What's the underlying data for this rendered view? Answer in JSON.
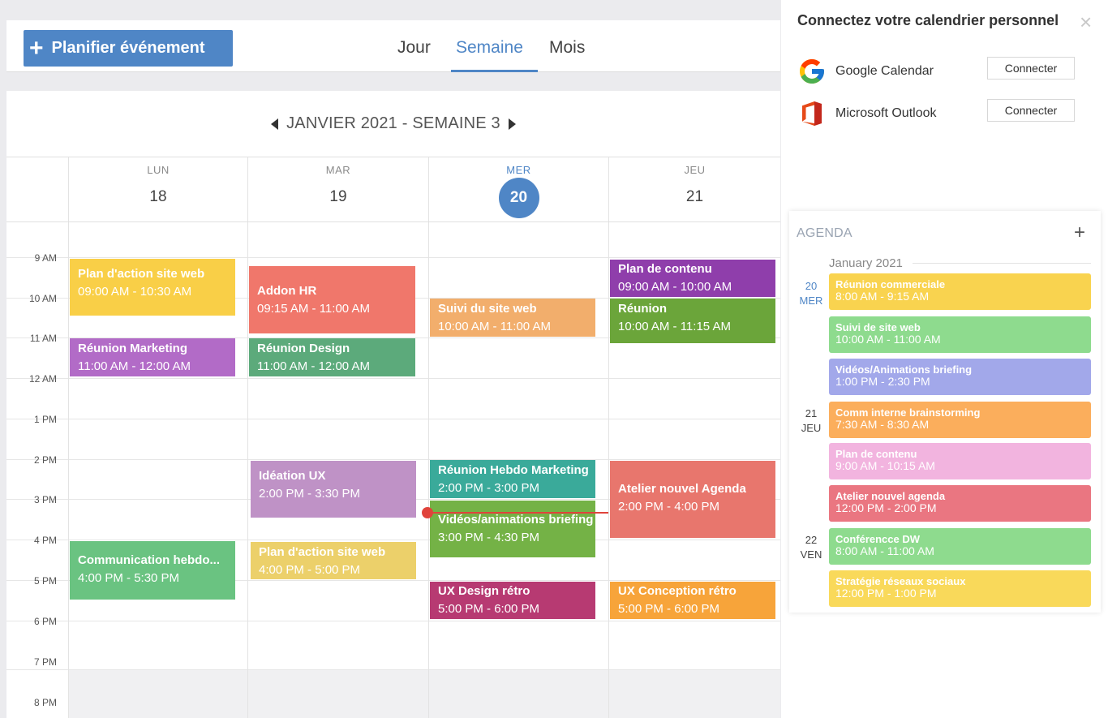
{
  "toolbar": {
    "plan_button_label": "Planifier événement",
    "plan_button_icon": "+",
    "tabs": [
      "Jour",
      "Semaine",
      "Mois"
    ],
    "active_tab": "Semaine"
  },
  "calendar": {
    "title": "JANVIER 2021 - SEMAINE 3",
    "days": [
      {
        "name": "LUN",
        "num": "18"
      },
      {
        "name": "MAR",
        "num": "19"
      },
      {
        "name": "MER",
        "num": "20"
      },
      {
        "name": "JEU",
        "num": "21"
      }
    ],
    "today": "20",
    "hours": [
      "9 AM",
      "10 AM",
      "11 AM",
      "12 AM",
      "1 PM",
      "2 PM",
      "3 PM",
      "4 PM",
      "5 PM",
      "6 PM",
      "7 PM",
      "8 PM"
    ],
    "events": [
      {
        "title": "Plan d'action site web",
        "time": "09:00 AM - 10:30 AM",
        "color": "#f9cf47"
      },
      {
        "title": "Réunion Marketing",
        "time": "11:00 AM - 12:00 AM",
        "color": "#b26bc7"
      },
      {
        "title": "Communication hebdo...",
        "time": "4:00 PM - 5:30 PM",
        "color": "#6ac381"
      },
      {
        "title": "Addon HR",
        "time": "09:15 AM - 11:00 AM",
        "color": "#f0776b"
      },
      {
        "title": "Réunion Design",
        "time": "11:00 AM - 12:00 AM",
        "color": "#5caa7b"
      },
      {
        "title": "Idéation UX",
        "time": "2:00 PM - 3:30 PM",
        "color": "#bf92c6"
      },
      {
        "title": "Plan d'action site web",
        "time": "4:00 PM - 5:00 PM",
        "color": "#ecd06a"
      },
      {
        "title": "Suivi du site web",
        "time": "10:00 AM - 11:00 AM",
        "color": "#f2ae6c"
      },
      {
        "title": "Réunion Hebdo Marketing",
        "time": "2:00 PM - 3:00 PM",
        "color": "#3aaa9a"
      },
      {
        "title": "Vidéos/animations briefing",
        "time": "3:00 PM - 4:30 PM",
        "color": "#74b246"
      },
      {
        "title": "UX  Design rétro",
        "time": "5:00 PM - 6:00 PM",
        "color": "#b73a72"
      },
      {
        "title": "Plan de contenu",
        "time": "09:00 AM - 10:00 AM",
        "color": "#8f3eab"
      },
      {
        "title": "Réunion",
        "time": "10:00 AM - 11:15 AM",
        "color": "#6ba53a"
      },
      {
        "title": "Atelier nouvel Agenda",
        "time": "2:00 PM - 4:00 PM",
        "color": "#e8766d"
      },
      {
        "title": "UX Conception rétro",
        "time": "5:00 PM - 6:00 PM",
        "color": "#f7a43a"
      }
    ]
  },
  "panel": {
    "title": "Connectez votre calendrier personnel",
    "close_icon": "×",
    "connections": [
      {
        "name": "Google Calendar",
        "button": "Connecter",
        "icon": "google-icon"
      },
      {
        "name": "Microsoft Outlook",
        "button": "Connecter",
        "icon": "office-icon"
      }
    ]
  },
  "agenda": {
    "title": "AGENDA",
    "add_icon": "+",
    "month": "January 2021",
    "dates": [
      {
        "num": "20",
        "day": "MER"
      },
      {
        "num": "21",
        "day": "JEU"
      },
      {
        "num": "22",
        "day": "VEN"
      }
    ],
    "events": [
      {
        "title": "Réunion commerciale",
        "time": "8:00 AM - 9:15 AM",
        "color": "#f9d34f"
      },
      {
        "title": "Suivi de site web",
        "time": "10:00 AM - 11:00 AM",
        "color": "#8edb8e"
      },
      {
        "title": "Vidéos/Animations briefing",
        "time": "1:00 PM - 2:30 PM",
        "color": "#a2a8ea"
      },
      {
        "title": "Comm interne brainstorming",
        "time": "7:30 AM - 8:30 AM",
        "color": "#fbae5c"
      },
      {
        "title": "Plan de contenu",
        "time": "9:00 AM - 10:15 AM",
        "color": "#f2b4df"
      },
      {
        "title": "Atelier nouvel agenda",
        "time": "12:00 PM - 2:00 PM",
        "color": "#ea7681"
      },
      {
        "title": "Conférencce DW",
        "time": "8:00 AM - 11:00 AM",
        "color": "#8edb8e"
      },
      {
        "title": "Stratégie réseaux sociaux",
        "time": "12:00 PM - 1:00 PM",
        "color": "#f9d95a"
      }
    ]
  }
}
